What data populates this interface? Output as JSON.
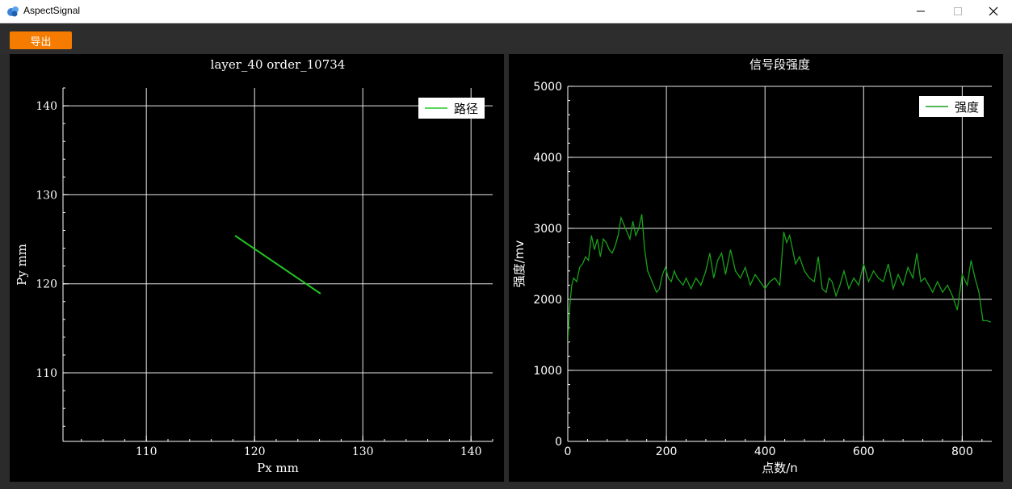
{
  "window": {
    "title": "AspectSignal",
    "app_icon": "app-logo-icon",
    "controls": [
      "minimize-icon",
      "maximize-icon",
      "close-icon"
    ]
  },
  "toolbar": {
    "export_label": "导出",
    "export_color": "#f57c00"
  },
  "chart_data": [
    {
      "type": "line",
      "title": "layer_40    order_10734",
      "xlabel": "Px mm",
      "ylabel": "Py mm",
      "xlim": [
        102.3,
        142
      ],
      "ylim": [
        102.3,
        142
      ],
      "xticks": [
        110,
        120,
        130,
        140
      ],
      "yticks": [
        110,
        120,
        130,
        140
      ],
      "grid": true,
      "legend": "top-right",
      "series": [
        {
          "name": "路径",
          "color": "#22c822",
          "x": [
            118.2,
            126.1
          ],
          "y": [
            125.4,
            118.9
          ]
        }
      ]
    },
    {
      "type": "line",
      "title": "信号段强度",
      "xlabel": "点数/n",
      "ylabel": "强度/mv",
      "xlim": [
        0,
        860
      ],
      "ylim": [
        0,
        5000
      ],
      "xticks": [
        0,
        200,
        400,
        600,
        800
      ],
      "yticks": [
        0,
        1000,
        2000,
        3000,
        4000,
        5000
      ],
      "grid": true,
      "legend": "top-right",
      "series": [
        {
          "name": "强度",
          "color": "#1aa01a",
          "x": [
            0,
            4,
            8,
            12,
            18,
            24,
            30,
            36,
            42,
            48,
            54,
            60,
            66,
            72,
            78,
            84,
            90,
            96,
            102,
            108,
            114,
            120,
            126,
            132,
            138,
            144,
            150,
            156,
            162,
            168,
            174,
            180,
            186,
            192,
            198,
            204,
            210,
            216,
            222,
            228,
            234,
            240,
            250,
            260,
            270,
            280,
            288,
            296,
            304,
            312,
            320,
            330,
            340,
            350,
            360,
            370,
            380,
            390,
            400,
            410,
            420,
            430,
            438,
            444,
            450,
            456,
            462,
            470,
            480,
            490,
            500,
            508,
            516,
            524,
            530,
            536,
            544,
            552,
            560,
            570,
            580,
            590,
            600,
            610,
            620,
            630,
            640,
            650,
            660,
            670,
            680,
            690,
            700,
            708,
            716,
            724,
            732,
            740,
            750,
            760,
            770,
            780,
            790,
            800,
            810,
            818,
            826,
            834,
            842,
            850,
            858
          ],
          "y": [
            1400,
            1900,
            2200,
            2300,
            2250,
            2450,
            2500,
            2600,
            2550,
            2900,
            2700,
            2850,
            2600,
            2850,
            2800,
            2700,
            2650,
            2750,
            2900,
            3150,
            3050,
            2950,
            2850,
            3100,
            2900,
            3000,
            3200,
            2700,
            2400,
            2300,
            2200,
            2100,
            2150,
            2350,
            2450,
            2300,
            2250,
            2400,
            2300,
            2250,
            2200,
            2300,
            2150,
            2300,
            2200,
            2400,
            2650,
            2300,
            2550,
            2650,
            2350,
            2700,
            2400,
            2300,
            2450,
            2200,
            2350,
            2250,
            2150,
            2250,
            2300,
            2200,
            2950,
            2800,
            2900,
            2700,
            2500,
            2600,
            2400,
            2300,
            2250,
            2600,
            2150,
            2100,
            2300,
            2250,
            2050,
            2200,
            2400,
            2150,
            2300,
            2200,
            2500,
            2250,
            2400,
            2300,
            2250,
            2500,
            2150,
            2350,
            2200,
            2450,
            2300,
            2650,
            2250,
            2300,
            2200,
            2100,
            2250,
            2100,
            2200,
            2050,
            1850,
            2350,
            2200,
            2550,
            2300,
            2100,
            1700,
            1700,
            1680
          ]
        }
      ]
    }
  ]
}
